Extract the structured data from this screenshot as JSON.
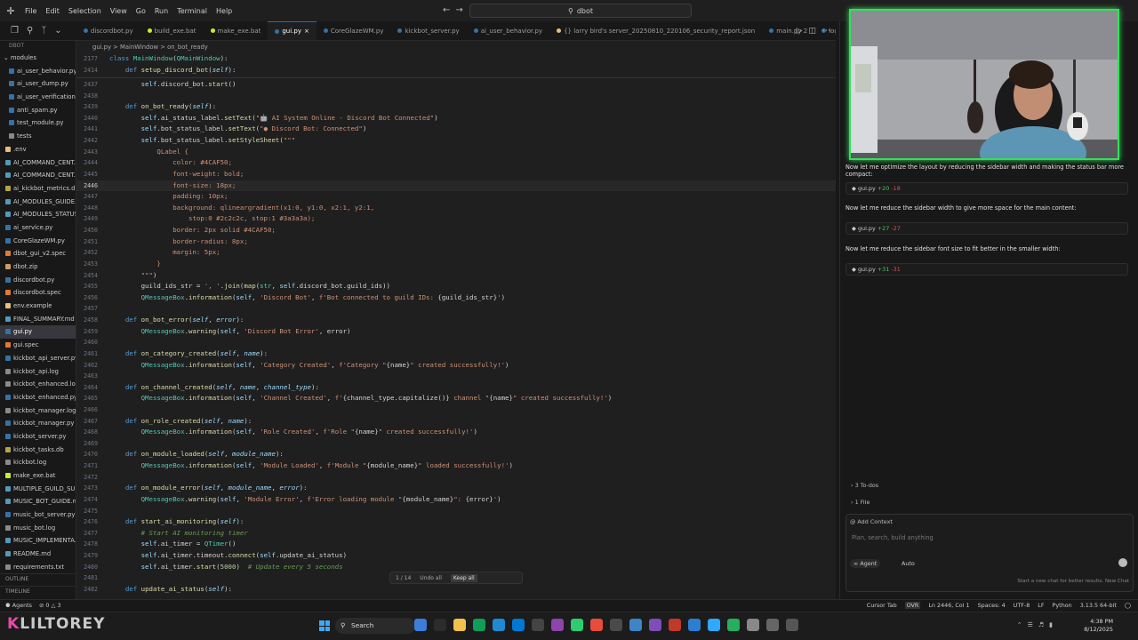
{
  "titlebar": {
    "menu": [
      "File",
      "Edit",
      "Selection",
      "View",
      "Go",
      "Run",
      "Terminal",
      "Help"
    ],
    "search": "dbot"
  },
  "explorer": {
    "root": "DBOT",
    "items": [
      {
        "label": "ai_user_behavior.py",
        "color": "#3572A5"
      },
      {
        "label": "ai_user_dump.py",
        "color": "#3572A5"
      },
      {
        "label": "ai_user_verification.py",
        "color": "#3572A5"
      },
      {
        "label": "anti_spam.py",
        "color": "#3572A5"
      },
      {
        "label": "test_module.py",
        "color": "#3572A5"
      },
      {
        "label": "tests",
        "color": "#888888"
      },
      {
        "label": ".env",
        "color": "#e5c07b"
      },
      {
        "label": "AI_COMMAND_CENT...",
        "color": "#519aba"
      },
      {
        "label": "AI_COMMAND_CENT...",
        "color": "#519aba"
      },
      {
        "label": "ai_kickbot_metrics.db",
        "color": "#b5a642"
      },
      {
        "label": "AI_MODULES_GUIDE...",
        "color": "#519aba"
      },
      {
        "label": "AI_MODULES_STATUS...",
        "color": "#519aba"
      },
      {
        "label": "ai_service.py",
        "color": "#3572A5"
      },
      {
        "label": "CoreGlazeWM.py",
        "color": "#3572A5"
      },
      {
        "label": "dbot_gui_v2.spec",
        "color": "#e37933"
      },
      {
        "label": "dbot.zip",
        "color": "#d19a66"
      },
      {
        "label": "discordbot.py",
        "color": "#3572A5"
      },
      {
        "label": "discordbot.spec",
        "color": "#e37933"
      },
      {
        "label": "env.example",
        "color": "#e5c07b"
      },
      {
        "label": "FINAL_SUMMARY.md",
        "color": "#519aba"
      },
      {
        "label": "gui.py",
        "color": "#3572A5"
      },
      {
        "label": "gui.spec",
        "color": "#e37933"
      },
      {
        "label": "kickbot_api_server.py",
        "color": "#3572A5"
      },
      {
        "label": "kickbot_api.log",
        "color": "#8a8a8a"
      },
      {
        "label": "kickbot_enhanced.log",
        "color": "#8a8a8a"
      },
      {
        "label": "kickbot_enhanced.py",
        "color": "#3572A5"
      },
      {
        "label": "kickbot_manager.log",
        "color": "#8a8a8a"
      },
      {
        "label": "kickbot_manager.py",
        "color": "#3572A5"
      },
      {
        "label": "kickbot_server.py",
        "color": "#3572A5"
      },
      {
        "label": "kickbot_tasks.db",
        "color": "#b5a642"
      },
      {
        "label": "kickbot.log",
        "color": "#8a8a8a"
      },
      {
        "label": "make_exe.bat",
        "color": "#c1f12e"
      },
      {
        "label": "MULTIPLE_GUILD_SU...",
        "color": "#519aba"
      },
      {
        "label": "MUSIC_BOT_GUIDE.md",
        "color": "#519aba"
      },
      {
        "label": "music_bot_server.py",
        "color": "#3572A5"
      },
      {
        "label": "music_bot.log",
        "color": "#8a8a8a"
      },
      {
        "label": "MUSIC_IMPLEMENTA...",
        "color": "#519aba"
      },
      {
        "label": "README.md",
        "color": "#519aba"
      },
      {
        "label": "requirements.txt",
        "color": "#8a8a8a"
      }
    ],
    "active_index": 20,
    "outline": "OUTLINE",
    "timeline": "TIMELINE"
  },
  "tabs": [
    {
      "label": "discordbot.py",
      "color": "#3572A5",
      "active": false
    },
    {
      "label": "build_exe.bat",
      "color": "#c1f12e",
      "active": false
    },
    {
      "label": "make_exe.bat",
      "color": "#c1f12e",
      "active": false
    },
    {
      "label": "gui.py",
      "color": "#3572A5",
      "active": true
    },
    {
      "label": "CoreGlazeWM.py",
      "color": "#3572A5",
      "active": false
    },
    {
      "label": "kickbot_server.py",
      "color": "#3572A5",
      "active": false
    },
    {
      "label": "ai_user_behavior.py",
      "color": "#3572A5",
      "active": false
    },
    {
      "label": "{} larry bird's server_20250810_220106_security_report.json",
      "color": "#e5c07b",
      "active": false
    },
    {
      "label": "main.py 2",
      "color": "#3572A5",
      "active": false
    },
    {
      "label": "logic.py",
      "color": "#3572A5",
      "active": false
    }
  ],
  "breadcrumb": "gui.py > MainWindow > on_bot_ready",
  "editor": {
    "current_line": "2446",
    "lines": [
      {
        "n": "2437",
        "html": "        <span class='slf'>self</span>.discord_bot.<span class='fn'>start</span>()"
      },
      {
        "n": "2438",
        "html": ""
      },
      {
        "n": "2439",
        "html": "    <span class='kw'>def</span> <span class='fn'>on_bot_ready</span>(<span class='par'>self</span>):"
      },
      {
        "n": "2440",
        "html": "        <span class='slf'>self</span>.ai_status_label.<span class='fn'>setText</span>(<span class='str'>\"&#129302; AI System Online - Discord Bot Connected\"</span>)"
      },
      {
        "n": "2441",
        "html": "        <span class='slf'>self</span>.bot_status_label.<span class='fn'>setText</span>(<span class='str'>\"&#9679; Discord Bot: Connected\"</span>)"
      },
      {
        "n": "2442",
        "html": "        <span class='slf'>self</span>.bot_status_label.<span class='fn'>setStyleSheet</span>(<span class='str'>\"\"\"</span>"
      },
      {
        "n": "2443",
        "html": "<span class='css'>            QLabel {</span>"
      },
      {
        "n": "2444",
        "html": "<span class='css'>                color: #4CAF50;</span>"
      },
      {
        "n": "2445",
        "html": "<span class='css'>                font-weight: bold;</span>"
      },
      {
        "n": "2446",
        "html": "<span class='css'>                font-size: 18px;</span>"
      },
      {
        "n": "2447",
        "html": "<span class='css'>                padding: 10px;</span>"
      },
      {
        "n": "2448",
        "html": "<span class='css'>                background: qlineargradient(x1:0, y1:0, x2:1, y2:1,</span>"
      },
      {
        "n": "2449",
        "html": "<span class='css'>                    stop:0 #2c2c2c, stop:1 #3a3a3a);</span>"
      },
      {
        "n": "2450",
        "html": "<span class='css'>                border: 2px solid #4CAF50;</span>"
      },
      {
        "n": "2451",
        "html": "<span class='css'>                border-radius: 8px;</span>"
      },
      {
        "n": "2452",
        "html": "<span class='css'>                margin: 5px;</span>"
      },
      {
        "n": "2453",
        "html": "<span class='css'>            }</span>"
      },
      {
        "n": "2454",
        "html": "<span class='str'>        \"\"\"</span>)"
      },
      {
        "n": "2455",
        "html": "        guild_ids_str = <span class='str'>', '</span>.<span class='fn'>join</span>(<span class='fn'>map</span>(<span class='cls'>str</span>, <span class='slf'>self</span>.discord_bot.guild_ids))"
      },
      {
        "n": "2456",
        "html": "        <span class='cls'>QMessageBox</span>.<span class='fn'>information</span>(<span class='slf'>self</span>, <span class='str'>'Discord Bot'</span>, <span class='str'>f'Bot connected to guild IDs: </span>{guild_ids_str}<span class='str'>'</span>)"
      },
      {
        "n": "2457",
        "html": ""
      },
      {
        "n": "2458",
        "html": "    <span class='kw'>def</span> <span class='fn'>on_bot_error</span>(<span class='par'>self</span>, <span class='par'>error</span>):"
      },
      {
        "n": "2459",
        "html": "        <span class='cls'>QMessageBox</span>.<span class='fn'>warning</span>(<span class='slf'>self</span>, <span class='str'>'Discord Bot Error'</span>, error)"
      },
      {
        "n": "2460",
        "html": ""
      },
      {
        "n": "2461",
        "html": "    <span class='kw'>def</span> <span class='fn'>on_category_created</span>(<span class='par'>self</span>, <span class='par'>name</span>):"
      },
      {
        "n": "2462",
        "html": "        <span class='cls'>QMessageBox</span>.<span class='fn'>information</span>(<span class='slf'>self</span>, <span class='str'>'Category Created'</span>, <span class='str'>f'Category \"</span>{name}<span class='str'>\" created successfully!'</span>)"
      },
      {
        "n": "2463",
        "html": ""
      },
      {
        "n": "2464",
        "html": "    <span class='kw'>def</span> <span class='fn'>on_channel_created</span>(<span class='par'>self</span>, <span class='par'>name</span>, <span class='par'>channel_type</span>):"
      },
      {
        "n": "2465",
        "html": "        <span class='cls'>QMessageBox</span>.<span class='fn'>information</span>(<span class='slf'>self</span>, <span class='str'>'Channel Created'</span>, <span class='str'>f'</span>{channel_type.capitalize()}<span class='str'> channel \"</span>{name}<span class='str'>\" created successfully!'</span>)"
      },
      {
        "n": "2466",
        "html": ""
      },
      {
        "n": "2467",
        "html": "    <span class='kw'>def</span> <span class='fn'>on_role_created</span>(<span class='par'>self</span>, <span class='par'>name</span>):"
      },
      {
        "n": "2468",
        "html": "        <span class='cls'>QMessageBox</span>.<span class='fn'>information</span>(<span class='slf'>self</span>, <span class='str'>'Role Created'</span>, <span class='str'>f'Role \"</span>{name}<span class='str'>\" created successfully!'</span>)"
      },
      {
        "n": "2469",
        "html": ""
      },
      {
        "n": "2470",
        "html": "    <span class='kw'>def</span> <span class='fn'>on_module_loaded</span>(<span class='par'>self</span>, <span class='par'>module_name</span>):"
      },
      {
        "n": "2471",
        "html": "        <span class='cls'>QMessageBox</span>.<span class='fn'>information</span>(<span class='slf'>self</span>, <span class='str'>'Module Loaded'</span>, <span class='str'>f'Module \"</span>{module_name}<span class='str'>\" loaded successfully!'</span>)"
      },
      {
        "n": "2472",
        "html": ""
      },
      {
        "n": "2473",
        "html": "    <span class='kw'>def</span> <span class='fn'>on_module_error</span>(<span class='par'>self</span>, <span class='par'>module_name</span>, <span class='par'>error</span>):"
      },
      {
        "n": "2474",
        "html": "        <span class='cls'>QMessageBox</span>.<span class='fn'>warning</span>(<span class='slf'>self</span>, <span class='str'>'Module Error'</span>, <span class='str'>f'Error loading module \"</span>{module_name}<span class='str'>\": </span>{error}<span class='str'>'</span>)"
      },
      {
        "n": "2475",
        "html": ""
      },
      {
        "n": "2476",
        "html": "    <span class='kw'>def</span> <span class='fn'>start_ai_monitoring</span>(<span class='par'>self</span>):"
      },
      {
        "n": "2477",
        "html": "        <span class='cmt'># Start AI monitoring timer</span>"
      },
      {
        "n": "2478",
        "html": "        <span class='slf'>self</span>.ai_timer = <span class='cls'>QTimer</span>()"
      },
      {
        "n": "2479",
        "html": "        <span class='slf'>self</span>.ai_timer.timeout.<span class='fn'>connect</span>(<span class='slf'>self</span>.update_ai_status)"
      },
      {
        "n": "2480",
        "html": "        <span class='slf'>self</span>.ai_timer.<span class='fn'>start</span>(<span class='num'>5000</span>)  <span class='cmt'># Update every 5 seconds</span>"
      },
      {
        "n": "2481",
        "html": ""
      },
      {
        "n": "2482",
        "html": "    <span class='kw'>def</span> <span class='fn'>update_ai_status</span>(<span class='par'>self</span>):"
      }
    ],
    "sticky": [
      {
        "n": "2177",
        "html": "<span class='kw'>class</span> <span class='cls'>MainWindow</span>(<span class='cls'>QMainWindow</span>):"
      },
      {
        "n": "2414",
        "html": "    <span class='kw'>def</span> <span class='fn'>setup_discord_bot</span>(<span class='par'>self</span>):"
      }
    ]
  },
  "findbar": {
    "count": "1 / 14",
    "undo": "Undo all",
    "keep": "Keep all"
  },
  "chat": {
    "messages": [
      "Now let me optimize the layout by reducing the sidebar width and making the status bar more compact:",
      "Now let me reduce the sidebar width to give more space for the main content:",
      "Now let me reduce the sidebar font size to fit better in the smaller width:"
    ],
    "files": [
      {
        "name": "gui.py",
        "add": "+20",
        "del": "-18"
      },
      {
        "name": "gui.py",
        "add": "+27",
        "del": "-27"
      },
      {
        "name": "gui.py",
        "add": "+31",
        "del": "-31"
      }
    ],
    "todos": "3 To-dos",
    "file_count": "1 File",
    "add_context": "@ Add Context",
    "placeholder": "Plan, search, build anything",
    "agent": "Agent",
    "auto": "Auto",
    "hint": "Start a new chat for better results.",
    "new_chat": "New Chat"
  },
  "statusbar": {
    "agents": "Agents",
    "problems": "0",
    "warnings": "3",
    "cursor_tab": "Cursor Tab",
    "ovr": "OVR",
    "position": "Ln 2446, Col 1",
    "spaces": "Spaces: 4",
    "encoding": "UTF-8",
    "eol": "LF",
    "language": "Python",
    "interpreter": "3.13.5 64-bit"
  },
  "taskbar": {
    "brand": "LILTOREY",
    "search": "Search",
    "time": "4:38 PM",
    "date": "8/12/2025",
    "app_colors": [
      "#3c7dd9",
      "#2c2c2c",
      "#f0c14b",
      "#0f9d58",
      "#1f8ad2",
      "#0078d4",
      "#444444",
      "#8e44ad",
      "#2ecc71",
      "#e74c3c",
      "#4a4a4a",
      "#3d85c6",
      "#7d4eb8",
      "#c0392b",
      "#2d7dd2",
      "#31a8ff",
      "#27ae60",
      "#888888",
      "#666666",
      "#555555"
    ]
  }
}
